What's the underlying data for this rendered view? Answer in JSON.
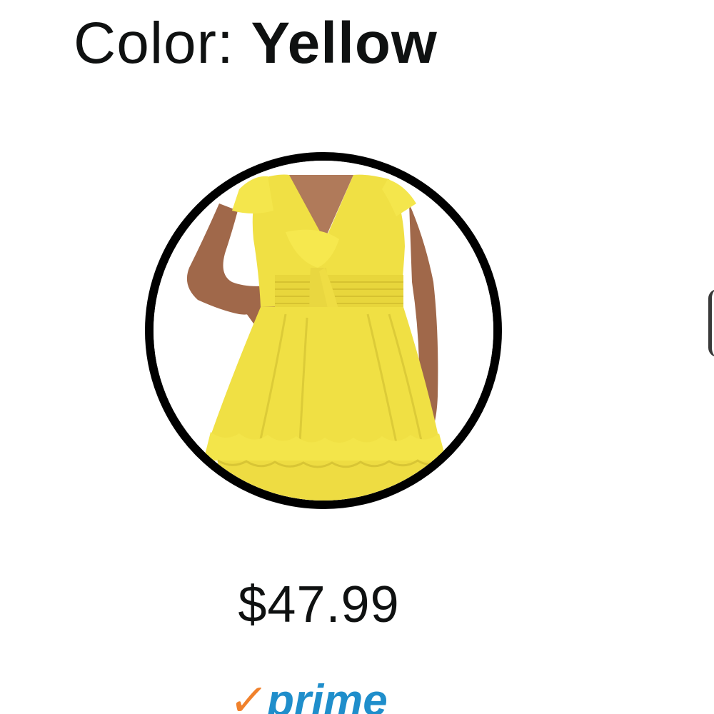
{
  "variation": {
    "label": "Color: ",
    "selected_value": "Yellow"
  },
  "swatch": {
    "image_alt": "Yellow dress",
    "selected": true,
    "dress_color": "#f0e044",
    "ring_color": "#000000"
  },
  "price": "$47.99",
  "prime": {
    "check_glyph": "✓",
    "label": "prime",
    "check_color": "#f0812c",
    "label_color": "#1f8ecb"
  }
}
